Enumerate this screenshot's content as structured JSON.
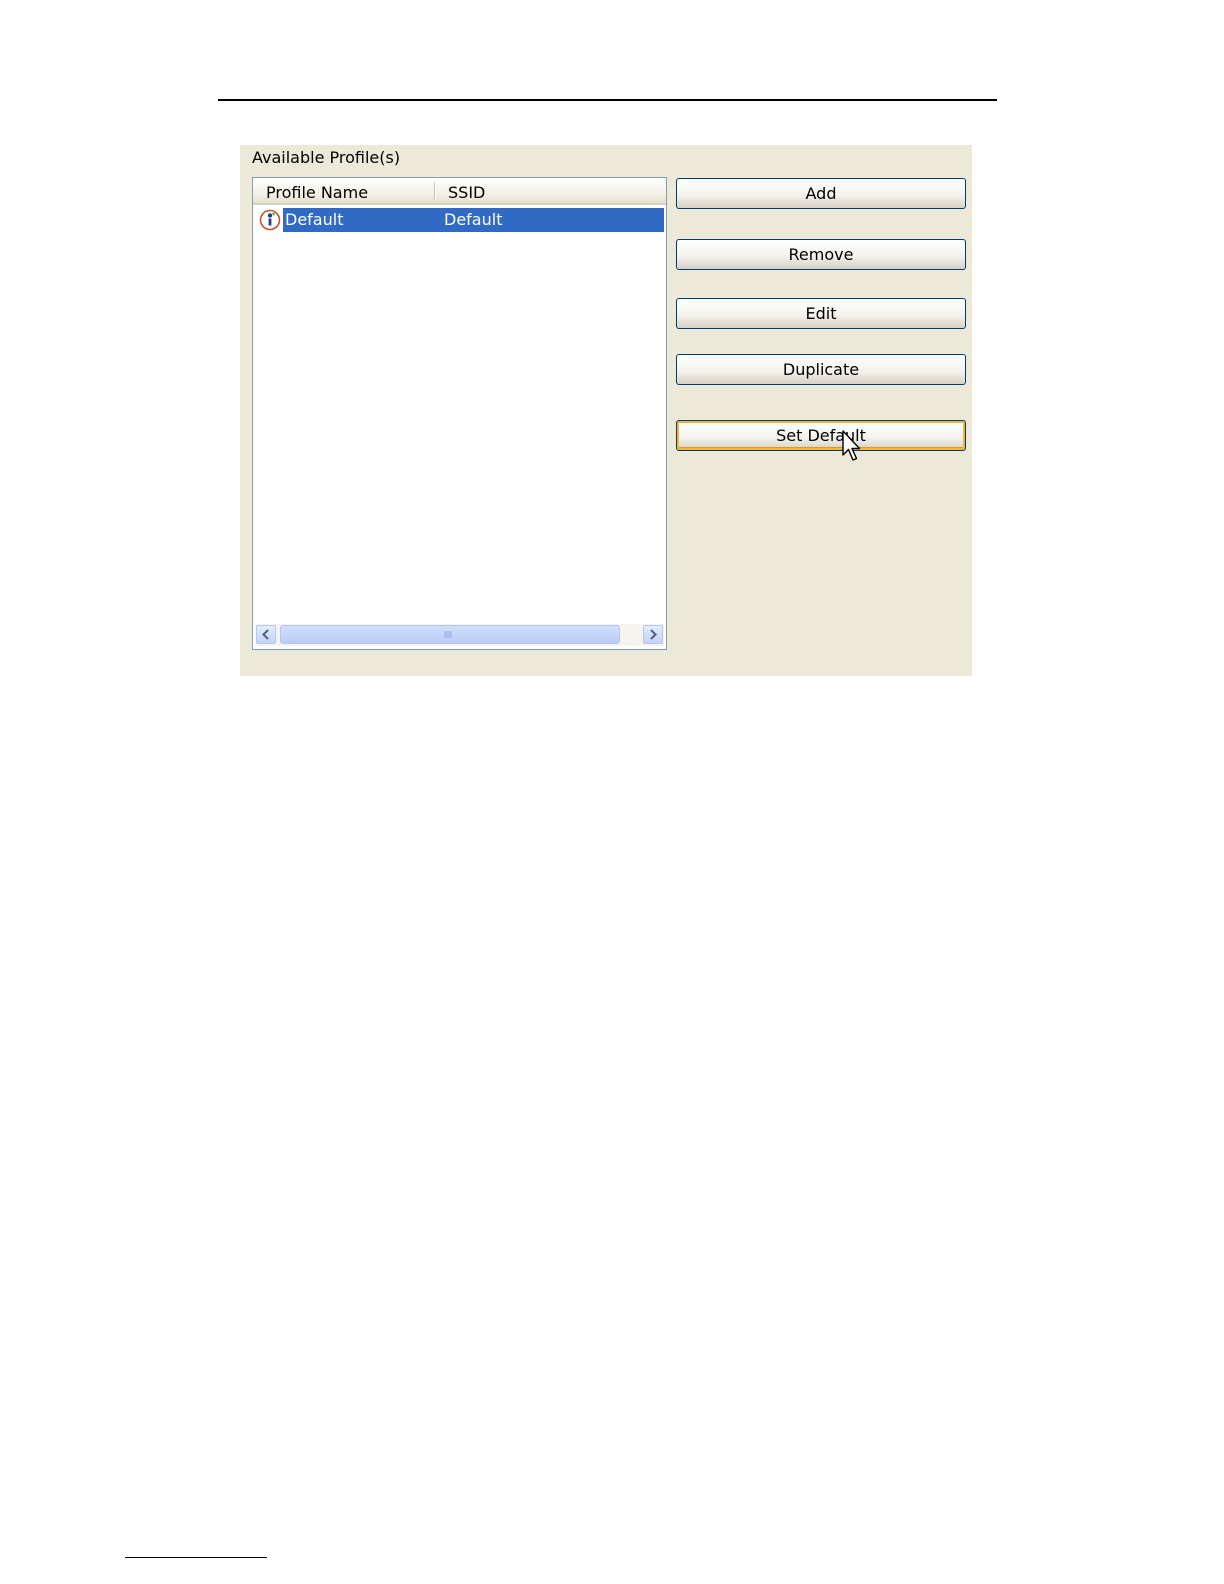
{
  "profiles_panel": {
    "title": "Available Profile(s)",
    "columns": [
      "Profile Name",
      "SSID"
    ],
    "rows": [
      {
        "profile_name": "Default",
        "ssid": "Default",
        "selected": true,
        "icon": "default-profile-icon"
      }
    ]
  },
  "buttons": {
    "add": "Add",
    "remove": "Remove",
    "edit": "Edit",
    "duplicate": "Duplicate",
    "set_default": "Set Default"
  },
  "colors": {
    "panel_bg": "#ece9d8",
    "selection": "#316ac5",
    "focus_ring": "#f8b330"
  }
}
